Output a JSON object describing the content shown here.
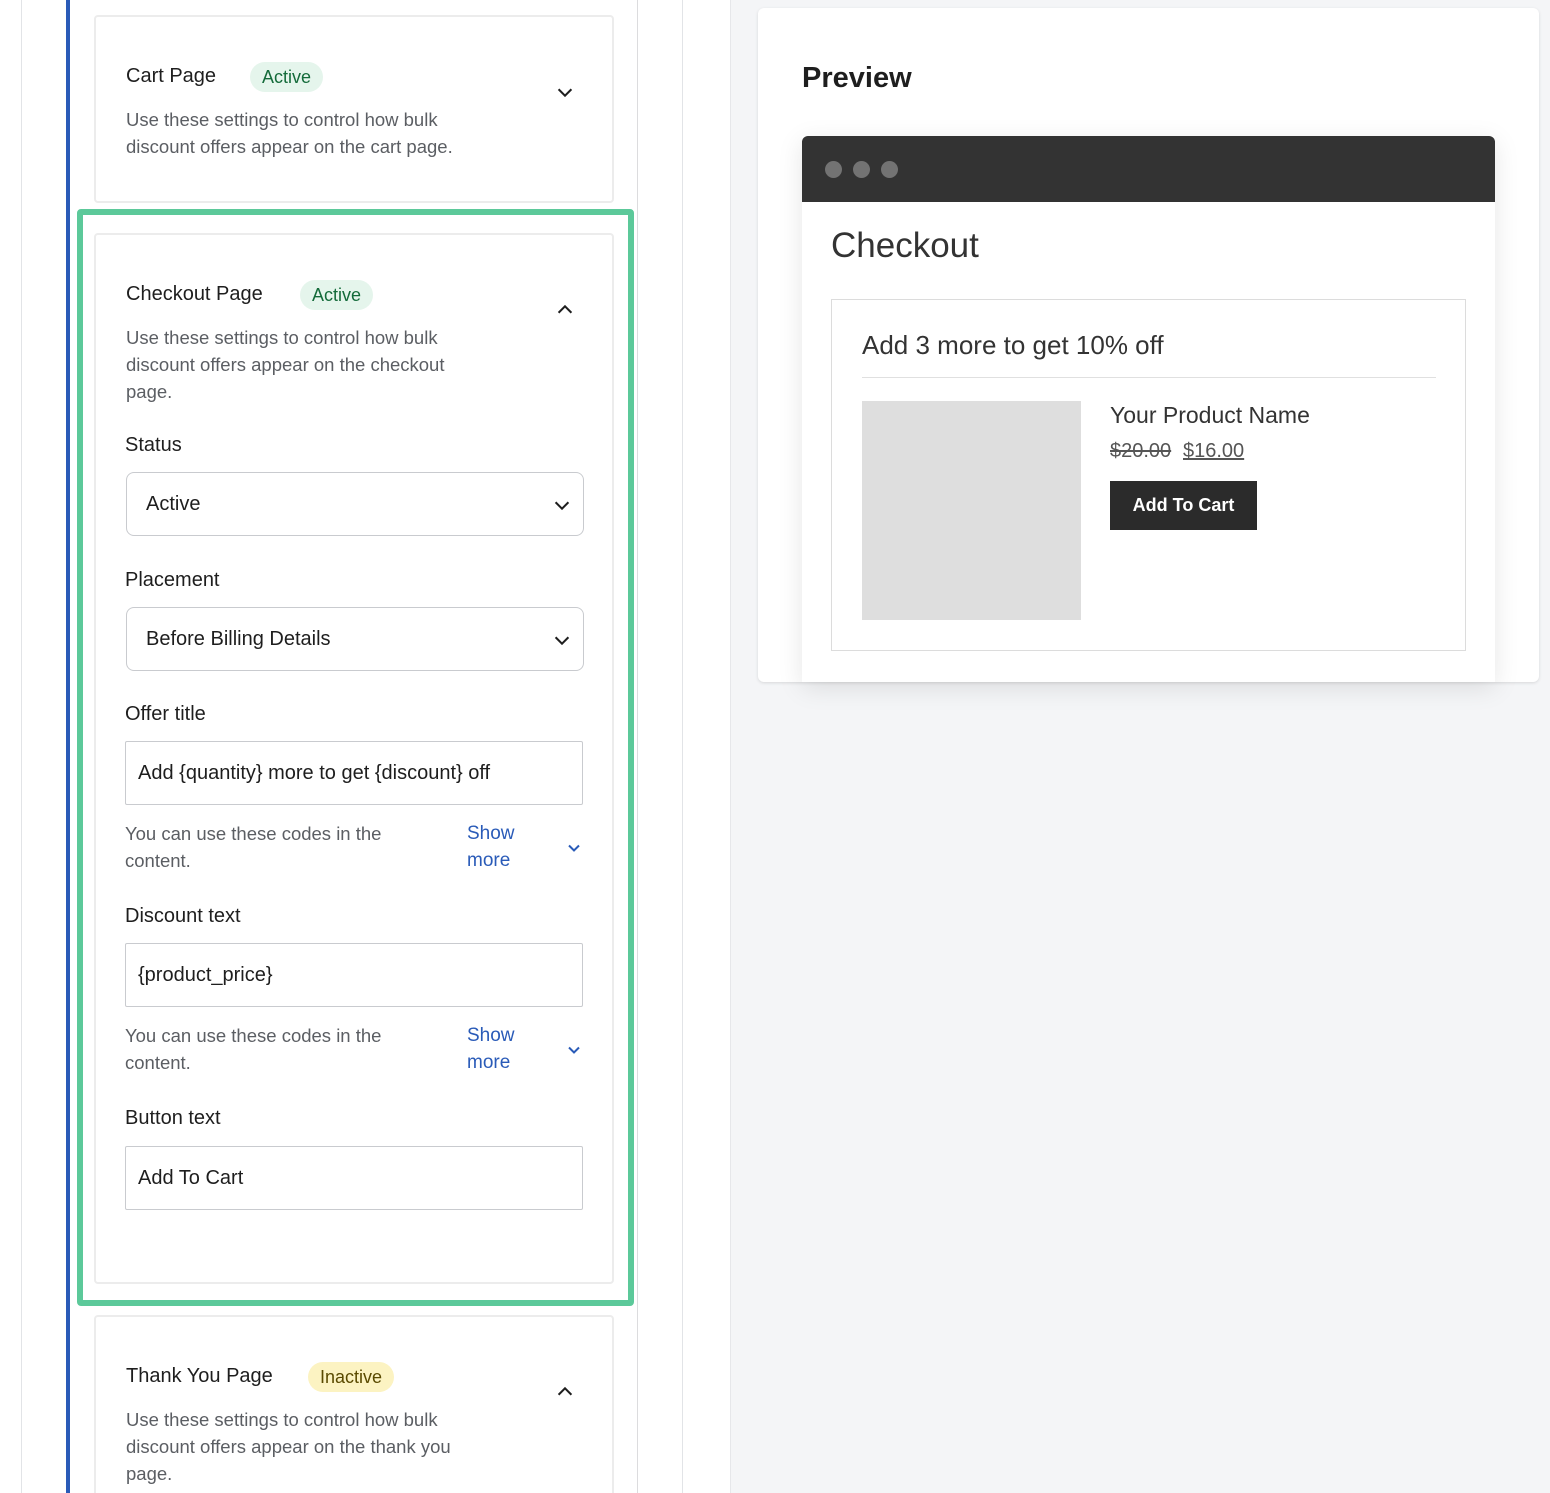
{
  "cart_section": {
    "title": "Cart Page",
    "badge": "Active",
    "description": "Use these settings to control how bulk discount offers appear on the cart page."
  },
  "checkout_section": {
    "title": "Checkout Page",
    "badge": "Active",
    "description": "Use these settings to control how bulk discount offers appear on the checkout page.",
    "status": {
      "label": "Status",
      "value": "Active"
    },
    "placement": {
      "label": "Placement",
      "value": "Before Billing Details"
    },
    "offer_title": {
      "label": "Offer title",
      "value": "Add {quantity} more to get {discount} off",
      "help": "You can use these codes in the content.",
      "show_more": "Show more"
    },
    "discount_text": {
      "label": "Discount text",
      "value": "{product_price}",
      "help": "You can use these codes in the content.",
      "show_more": "Show more"
    },
    "button_text": {
      "label": "Button text",
      "value": "Add To Cart"
    }
  },
  "thankyou_section": {
    "title": "Thank You Page",
    "badge": "Inactive",
    "description": "Use these settings to control how bulk discount offers appear on the thank you page."
  },
  "preview": {
    "heading": "Preview",
    "page_title": "Checkout",
    "offer_title": "Add 3 more to get 10% off",
    "product_name": "Your Product Name",
    "price_old": "$20.00",
    "price_new": "$16.00",
    "button": "Add To Cart"
  },
  "colors": {
    "highlight": "#5cc99a",
    "accent_blue": "#2a5bb8",
    "active_badge_bg": "#e5f5ec",
    "inactive_badge_bg": "#fcf3c2",
    "browser_bar": "#333333"
  },
  "icons": [
    "chevron-down-icon",
    "chevron-up-icon"
  ]
}
